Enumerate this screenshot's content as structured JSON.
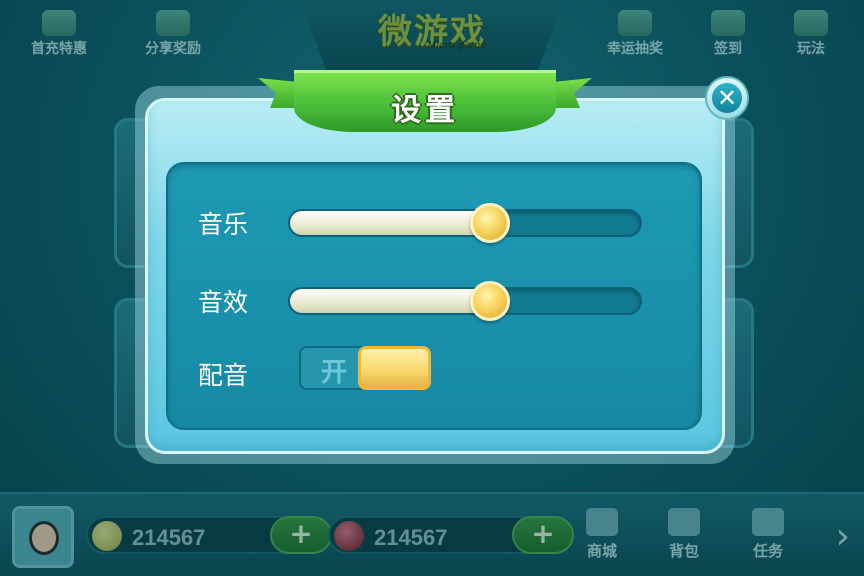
{
  "top_bar": {
    "logo": "微游戏",
    "logo_sub": "Micro game",
    "left_items": [
      "首充特惠",
      "分享奖励"
    ],
    "right_items": [
      "幸运抽奖",
      "签到",
      "玩法"
    ]
  },
  "bottom_bar": {
    "gold": "214567",
    "gems": "214567",
    "plus": "+",
    "nav": [
      "商城",
      "背包",
      "任务"
    ],
    "next": "›"
  },
  "settings": {
    "title": "设置",
    "close": "✕",
    "music_label": "音乐",
    "music_level": 0.57,
    "sfx_label": "音效",
    "sfx_level": 0.57,
    "voice_label": "配音",
    "voice_toggle_text": "开",
    "voice_on": true
  },
  "colors": {
    "accent": "#4cc13a",
    "panel": "#1e9ab4",
    "knob": "#f6d360"
  }
}
